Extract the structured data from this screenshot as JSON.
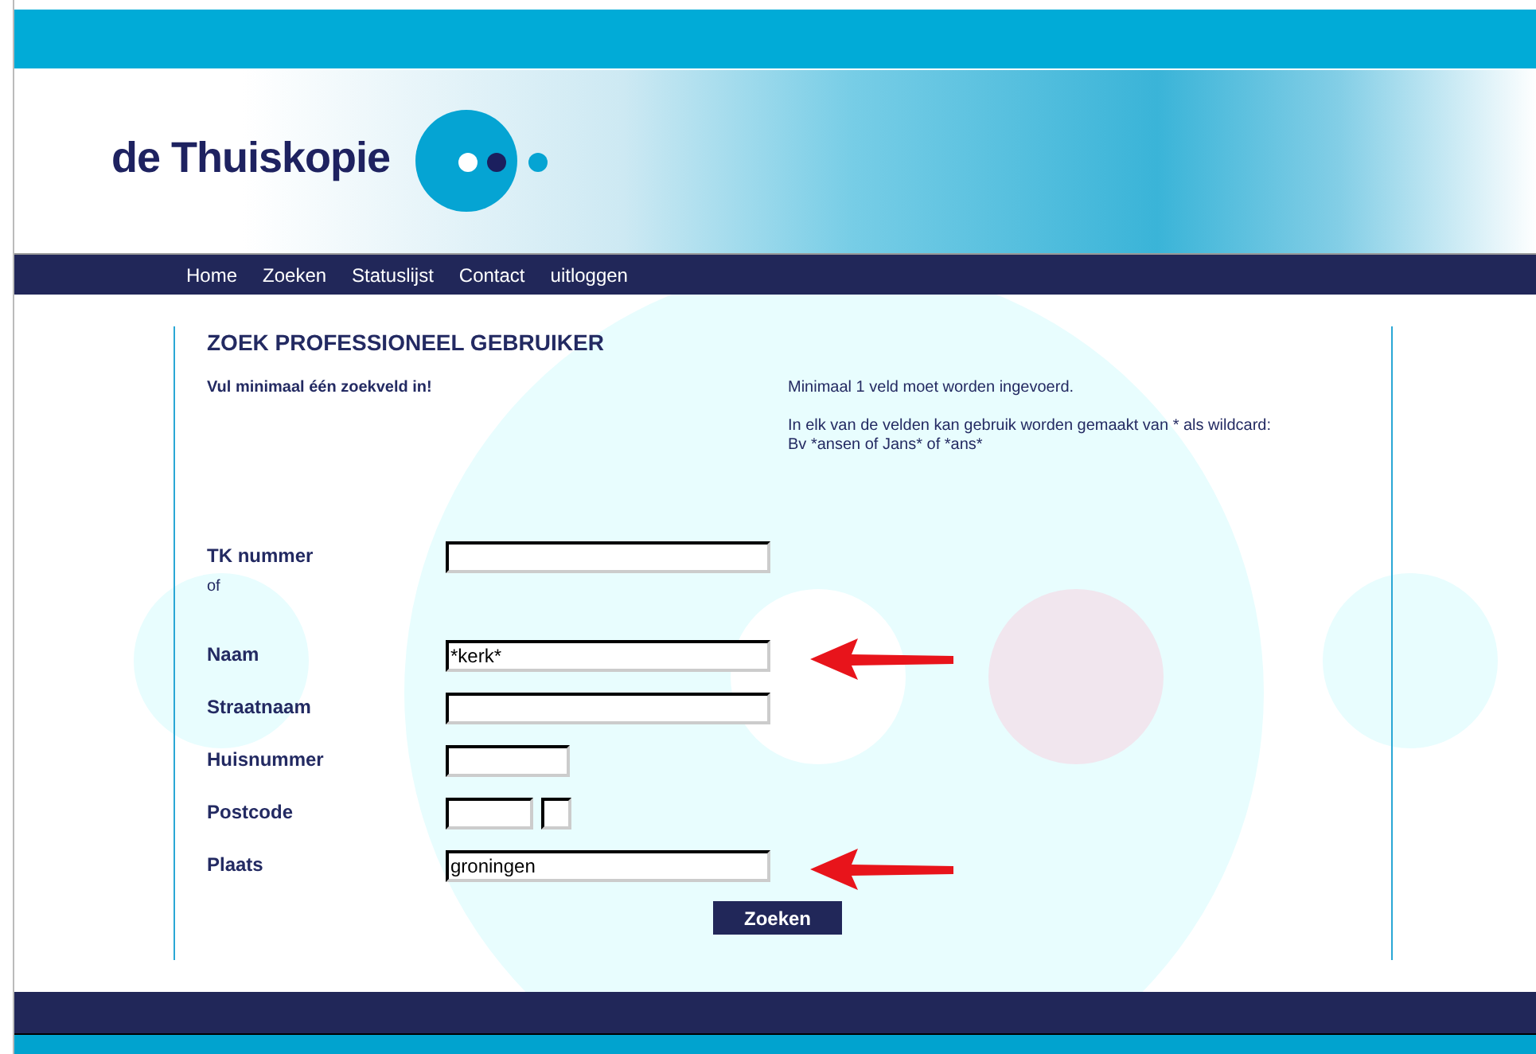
{
  "logo": {
    "text": "de Thuiskopie"
  },
  "nav": [
    "Home",
    "Zoeken",
    "Statuslijst",
    "Contact",
    "uitloggen"
  ],
  "title": "ZOEK PROFESSIONEEL GEBRUIKER",
  "instruction": "Vul minimaal één zoekveld in!",
  "notes": [
    "Minimaal 1 veld moet worden ingevoerd.",
    "In elk van de velden kan gebruik worden gemaakt van * als wildcard:\nBv *ansen of Jans* of *ans*"
  ],
  "fields": [
    {
      "label": "TK nummer",
      "kind": "long",
      "note": "of",
      "arrow": false
    },
    {
      "label": "Naam",
      "kind": "long",
      "value": "*kerk*",
      "arrow": true
    },
    {
      "label": "Straatnaam",
      "kind": "long",
      "arrow": false
    },
    {
      "label": "Huisnummer",
      "kind": "short",
      "arrow": false
    },
    {
      "label": "Postcode",
      "kind": "postcode",
      "arrow": false
    },
    {
      "label": "Plaats",
      "kind": "long",
      "value": "groningen",
      "arrow": true
    }
  ],
  "submit": "Zoeken"
}
